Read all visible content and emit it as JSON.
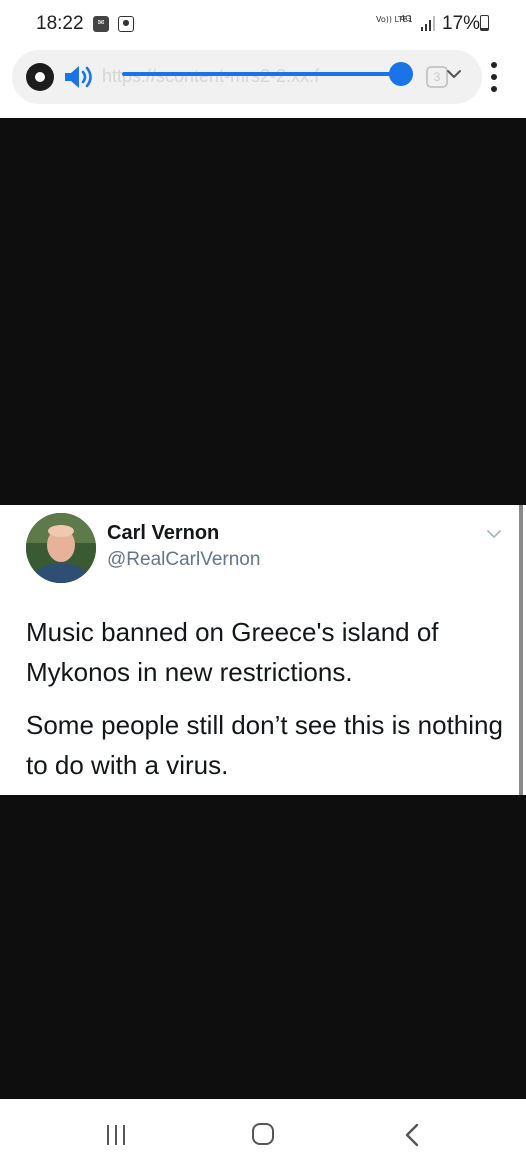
{
  "status_bar": {
    "time": "18:22",
    "network": "Vo)) LTE1",
    "network_type": "4G",
    "battery": "17%"
  },
  "browser": {
    "url": "https://scontent-mrs2-2.xx.f",
    "tabs_count": "3",
    "accent_color": "#1a73e8"
  },
  "media_volume": 0.93,
  "tweet": {
    "display_name": "Carl Vernon",
    "handle": "@RealCarlVernon",
    "paragraph_1": "Music banned on Greece's island of Mykonos in new restrictions.",
    "paragraph_2": "Some people still don’t see this is nothing to do with a virus."
  },
  "icons": {
    "site": "site-info-icon",
    "volume": "volume-icon",
    "menu": "more-vert-icon",
    "nav_recent": "recent-apps-icon",
    "nav_home": "home-icon",
    "nav_back": "back-icon"
  }
}
